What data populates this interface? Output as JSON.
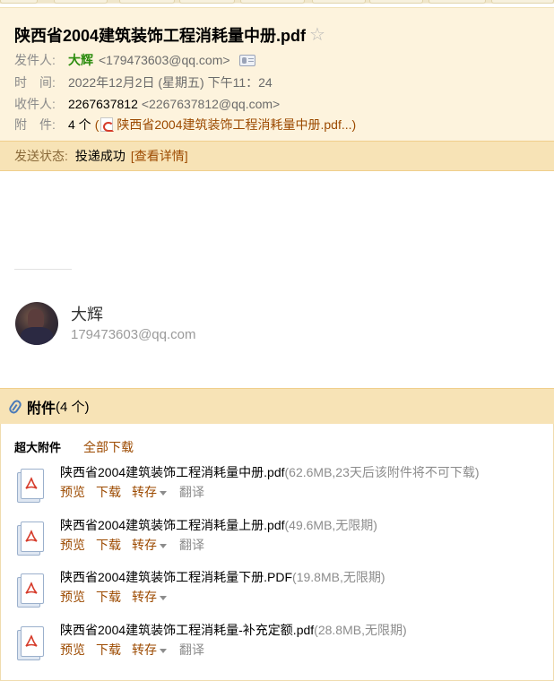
{
  "email": {
    "subject": "陕西省2004建筑装饰工程消耗量中册.pdf",
    "star_icon": "star-outline",
    "from": {
      "label": "发件人:",
      "name": "大辉",
      "address": "<179473603@qq.com>"
    },
    "time": {
      "label": "时　间:",
      "value": "2022年12月2日 (星期五) 下午11：24"
    },
    "to": {
      "label": "收件人:",
      "name": "2267637812",
      "address": "<2267637812@qq.com>"
    },
    "attachments_summary": {
      "label": "附　件:",
      "count": "4 个",
      "open_paren": "(",
      "first_file": "陕西省2004建筑装饰工程消耗量中册.pdf...",
      "close_paren": ")"
    },
    "status": {
      "label": "发送状态:",
      "value": "投递成功",
      "link": "[查看详情]"
    }
  },
  "signature": {
    "name": "大辉",
    "email": "179473603@qq.com"
  },
  "attachments": {
    "title": "附件",
    "count": "(4 个)",
    "big_label": "超大附件",
    "download_all": "全部下载",
    "files": [
      {
        "name": "陕西省2004建筑装饰工程消耗量中册.pdf",
        "meta": "(62.6MB,23天后该附件将不可下载)"
      },
      {
        "name": "陕西省2004建筑装饰工程消耗量上册.pdf",
        "meta": "(49.6MB,无限期)"
      },
      {
        "name": "陕西省2004建筑装饰工程消耗量下册.PDF",
        "meta": "(19.8MB,无限期)"
      },
      {
        "name": "陕西省2004建筑装饰工程消耗量-补充定额.pdf",
        "meta": "(28.8MB,无限期)"
      }
    ],
    "actions": {
      "preview": "预览",
      "download": "下载",
      "forward": "转存",
      "translate": "翻译"
    }
  },
  "colors": {
    "link": "#9c4a00",
    "sender_name": "#2b8c0e",
    "header_bg": "#fdf3dd",
    "status_bg": "#f7e3b6"
  }
}
